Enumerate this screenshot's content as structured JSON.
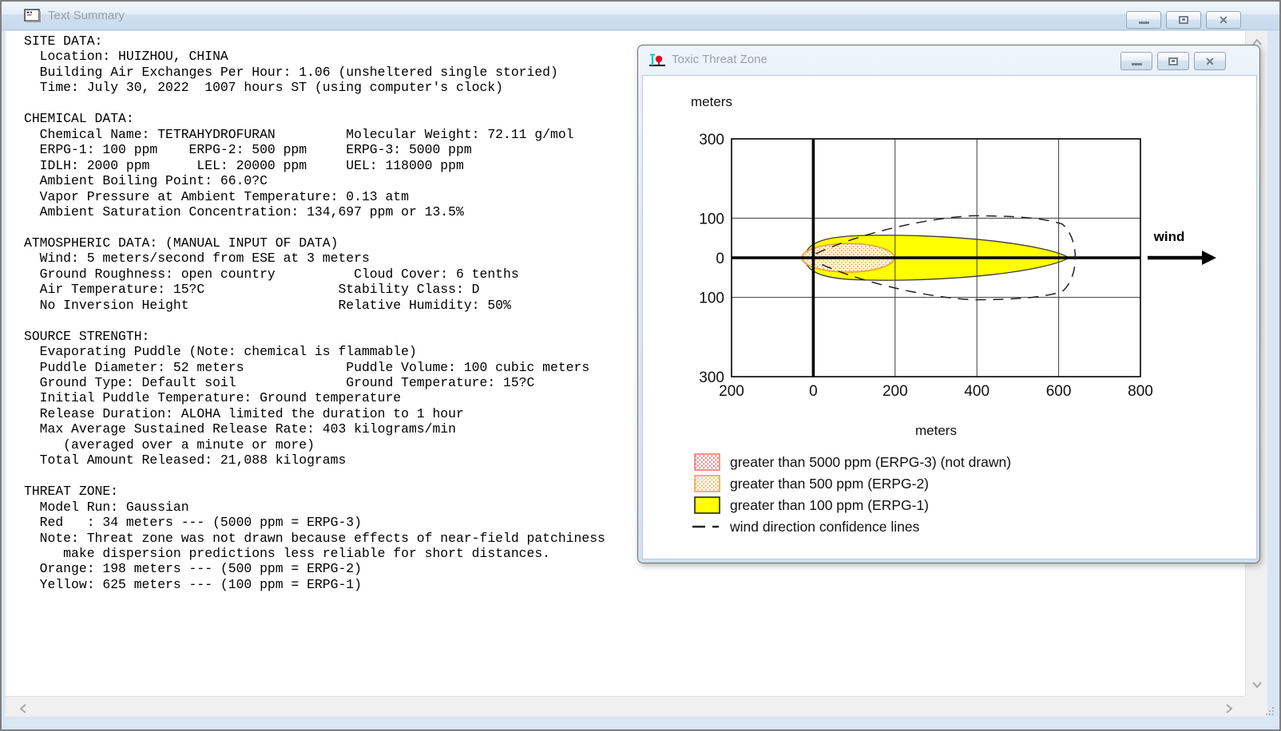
{
  "text_window": {
    "title": "Text Summary",
    "lines": [
      "SITE DATA:",
      "  Location: HUIZHOU, CHINA",
      "  Building Air Exchanges Per Hour: 1.06 (unsheltered single storied)",
      "  Time: July 30, 2022  1007 hours ST (using computer's clock)",
      "",
      "CHEMICAL DATA:",
      "  Chemical Name: TETRAHYDROFURAN         Molecular Weight: 72.11 g/mol",
      "  ERPG-1: 100 ppm    ERPG-2: 500 ppm     ERPG-3: 5000 ppm",
      "  IDLH: 2000 ppm      LEL: 20000 ppm     UEL: 118000 ppm",
      "  Ambient Boiling Point: 66.0?C",
      "  Vapor Pressure at Ambient Temperature: 0.13 atm",
      "  Ambient Saturation Concentration: 134,697 ppm or 13.5%",
      "",
      "ATMOSPHERIC DATA: (MANUAL INPUT OF DATA)",
      "  Wind: 5 meters/second from ESE at 3 meters",
      "  Ground Roughness: open country          Cloud Cover: 6 tenths",
      "  Air Temperature: 15?C                 Stability Class: D",
      "  No Inversion Height                   Relative Humidity: 50%",
      "",
      "SOURCE STRENGTH:",
      "  Evaporating Puddle (Note: chemical is flammable)",
      "  Puddle Diameter: 52 meters             Puddle Volume: 100 cubic meters",
      "  Ground Type: Default soil              Ground Temperature: 15?C",
      "  Initial Puddle Temperature: Ground temperature",
      "  Release Duration: ALOHA limited the duration to 1 hour",
      "  Max Average Sustained Release Rate: 403 kilograms/min",
      "     (averaged over a minute or more)",
      "  Total Amount Released: 21,088 kilograms",
      "",
      "THREAT ZONE:",
      "  Model Run: Gaussian",
      "  Red   : 34 meters --- (5000 ppm = ERPG-3)",
      "  Note: Threat zone was not drawn because effects of near-field patchiness",
      "     make dispersion predictions less reliable for short distances.",
      "  Orange: 198 meters --- (500 ppm = ERPG-2)",
      "  Yellow: 625 meters --- (100 ppm = ERPG-1)"
    ]
  },
  "threat_window": {
    "title": "Toxic Threat Zone",
    "wind_label": "wind",
    "legend": [
      {
        "swatch": "red-dots",
        "label": "greater than 5000 ppm (ERPG-3) (not drawn)"
      },
      {
        "swatch": "orange-dots",
        "label": "greater than 500 ppm (ERPG-2)"
      },
      {
        "swatch": "yellow-solid",
        "label": "greater than 100 ppm (ERPG-1)"
      },
      {
        "swatch": "dashed-line",
        "label": "wind direction confidence lines"
      }
    ]
  },
  "chart_data": {
    "type": "area",
    "title": "Toxic Threat Zone footprint plot",
    "xlabel": "meters",
    "ylabel": "meters",
    "xlim": [
      -200,
      800
    ],
    "ylim": [
      -300,
      300
    ],
    "x_tick_values": [
      -200,
      0,
      200,
      400,
      600,
      800
    ],
    "x_tick_labels": [
      "200",
      "0",
      "200",
      "400",
      "600",
      "800"
    ],
    "y_tick_values": [
      300,
      100,
      0,
      -100,
      -300
    ],
    "y_tick_labels": [
      "300",
      "100",
      "0",
      "100",
      "300"
    ],
    "grid_x": [
      200,
      400,
      600
    ],
    "grid_y": [
      100,
      -100
    ],
    "wind_direction": "left-to-right (downwind toward +x)",
    "zones": [
      {
        "name": "ERPG-3 (5000 ppm)",
        "downwind_m": 34,
        "drawn": false,
        "color": "#e8524a"
      },
      {
        "name": "ERPG-2 (500 ppm)",
        "downwind_m": 198,
        "upwind_m": 28,
        "max_half_width_m": 36,
        "drawn": true,
        "color": "#f2a33c",
        "fill": "dots"
      },
      {
        "name": "ERPG-1 (100 ppm)",
        "downwind_m": 625,
        "upwind_m": 20,
        "max_half_width_m": 57,
        "drawn": true,
        "color": "#ffff00",
        "fill": "solid"
      }
    ],
    "confidence_lines": {
      "downwind_m": 648,
      "max_half_width_m": 106
    }
  }
}
